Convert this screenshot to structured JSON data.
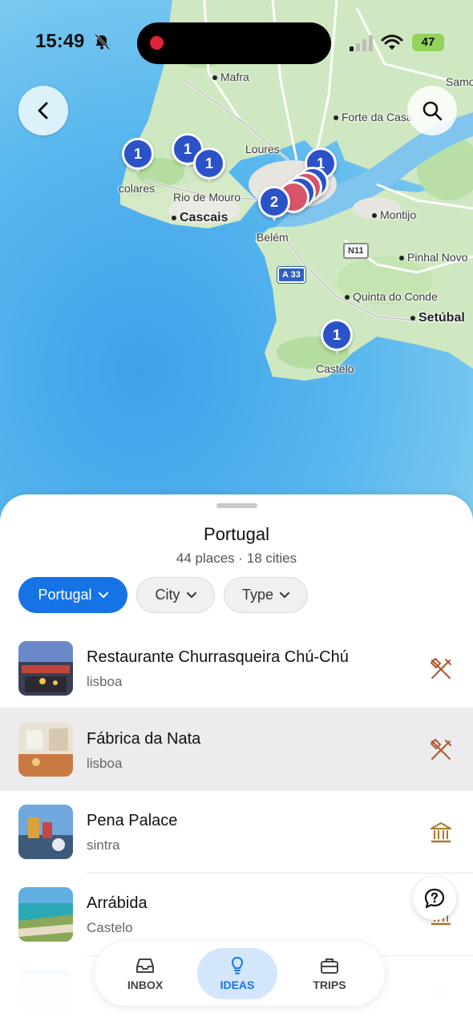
{
  "status_bar": {
    "time": "15:49",
    "battery": "47",
    "icons": [
      "bell-off-icon",
      "signal-icon",
      "wifi-icon",
      "battery-icon"
    ],
    "recording_color": "#e0243a"
  },
  "map": {
    "labels": {
      "mafra": "Mafra",
      "loures": "Loures",
      "forte_da_casa": "Forte da Casa",
      "samora": "Samora",
      "colares": "colares",
      "rio_de_mouro": "Rio de Mouro",
      "cascais": "Cascais",
      "belem": "Belém",
      "montijo": "Montijo",
      "pinhal_novo": "Pinhal Novo",
      "quinta_do_conde": "Quinta do Conde",
      "setubal": "Setúbal",
      "castelo": "Castelo"
    },
    "roads": {
      "n11": "N11",
      "a33": "A 33"
    },
    "pins": {
      "colares": "1",
      "sintra_a": "1",
      "sintra_b": "1",
      "lisbon_north": "1",
      "lisbon_cluster": "2",
      "castelo": "1"
    },
    "colors": {
      "pin": "#2c52c9",
      "water": "#4eaeed",
      "land": "#cfe8c2"
    }
  },
  "buttons": {
    "back_icon": "chevron-left-icon",
    "search_icon": "search-icon",
    "help_icon": "help-bubble-icon"
  },
  "sheet": {
    "title": "Portugal",
    "subtitle": "44 places · 18 cities",
    "filters": [
      {
        "label": "Portugal",
        "active": true
      },
      {
        "label": "City",
        "active": false
      },
      {
        "label": "Type",
        "active": false
      }
    ],
    "places": [
      {
        "name": "Restaurante Churrasqueira Chú-Chú",
        "city": "lisboa",
        "type_icon": "restaurant-icon"
      },
      {
        "name": "Fábrica da Nata",
        "city": "lisboa",
        "type_icon": "restaurant-icon"
      },
      {
        "name": "Pena Palace",
        "city": "sintra",
        "type_icon": "landmark-icon"
      },
      {
        "name": "Arrábida",
        "city": "Castelo",
        "type_icon": "landmark-icon"
      }
    ]
  },
  "nav": {
    "items": [
      {
        "label": "INBOX",
        "icon": "inbox-icon",
        "active": false
      },
      {
        "label": "IDEAS",
        "icon": "lightbulb-icon",
        "active": true
      },
      {
        "label": "TRIPS",
        "icon": "suitcase-icon",
        "active": false
      }
    ],
    "accent": "#1673e6"
  }
}
